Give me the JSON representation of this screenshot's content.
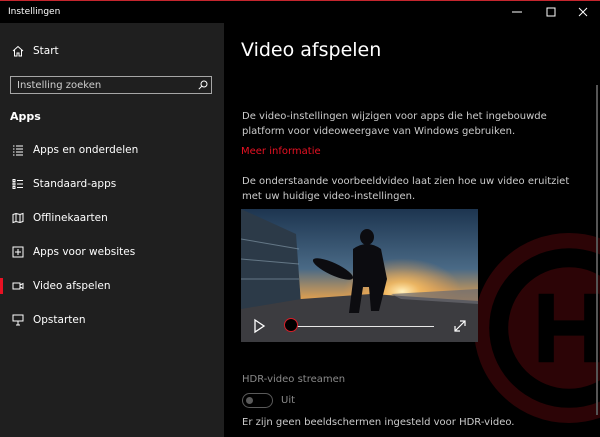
{
  "window": {
    "title": "Instellingen",
    "accent_color": "#e81123"
  },
  "sidebar": {
    "home_label": "Start",
    "search_placeholder": "Instelling zoeken",
    "section_heading": "Apps",
    "items": [
      {
        "label": "Apps en onderdelen",
        "icon": "list-icon"
      },
      {
        "label": "Standaard-apps",
        "icon": "default-apps-icon"
      },
      {
        "label": "Offlinekaarten",
        "icon": "map-icon"
      },
      {
        "label": "Apps voor websites",
        "icon": "open-external-icon"
      },
      {
        "label": "Video afspelen",
        "icon": "video-icon",
        "selected": true
      },
      {
        "label": "Opstarten",
        "icon": "startup-icon"
      }
    ]
  },
  "content": {
    "title": "Video afspelen",
    "description": "De video-instellingen wijzigen voor apps die het ingebouwde platform voor videoweergave van Windows gebruiken.",
    "more_info_link": "Meer informatie",
    "preview_description": "De onderstaande voorbeeldvideo laat zien hoe uw video eruitziet met uw huidige video-instellingen.",
    "video": {
      "progress": 0
    },
    "hdr": {
      "label": "HDR-video streamen",
      "state": "Uit",
      "note": "Er zijn geen beeldschermen ingesteld voor HDR-video."
    }
  }
}
